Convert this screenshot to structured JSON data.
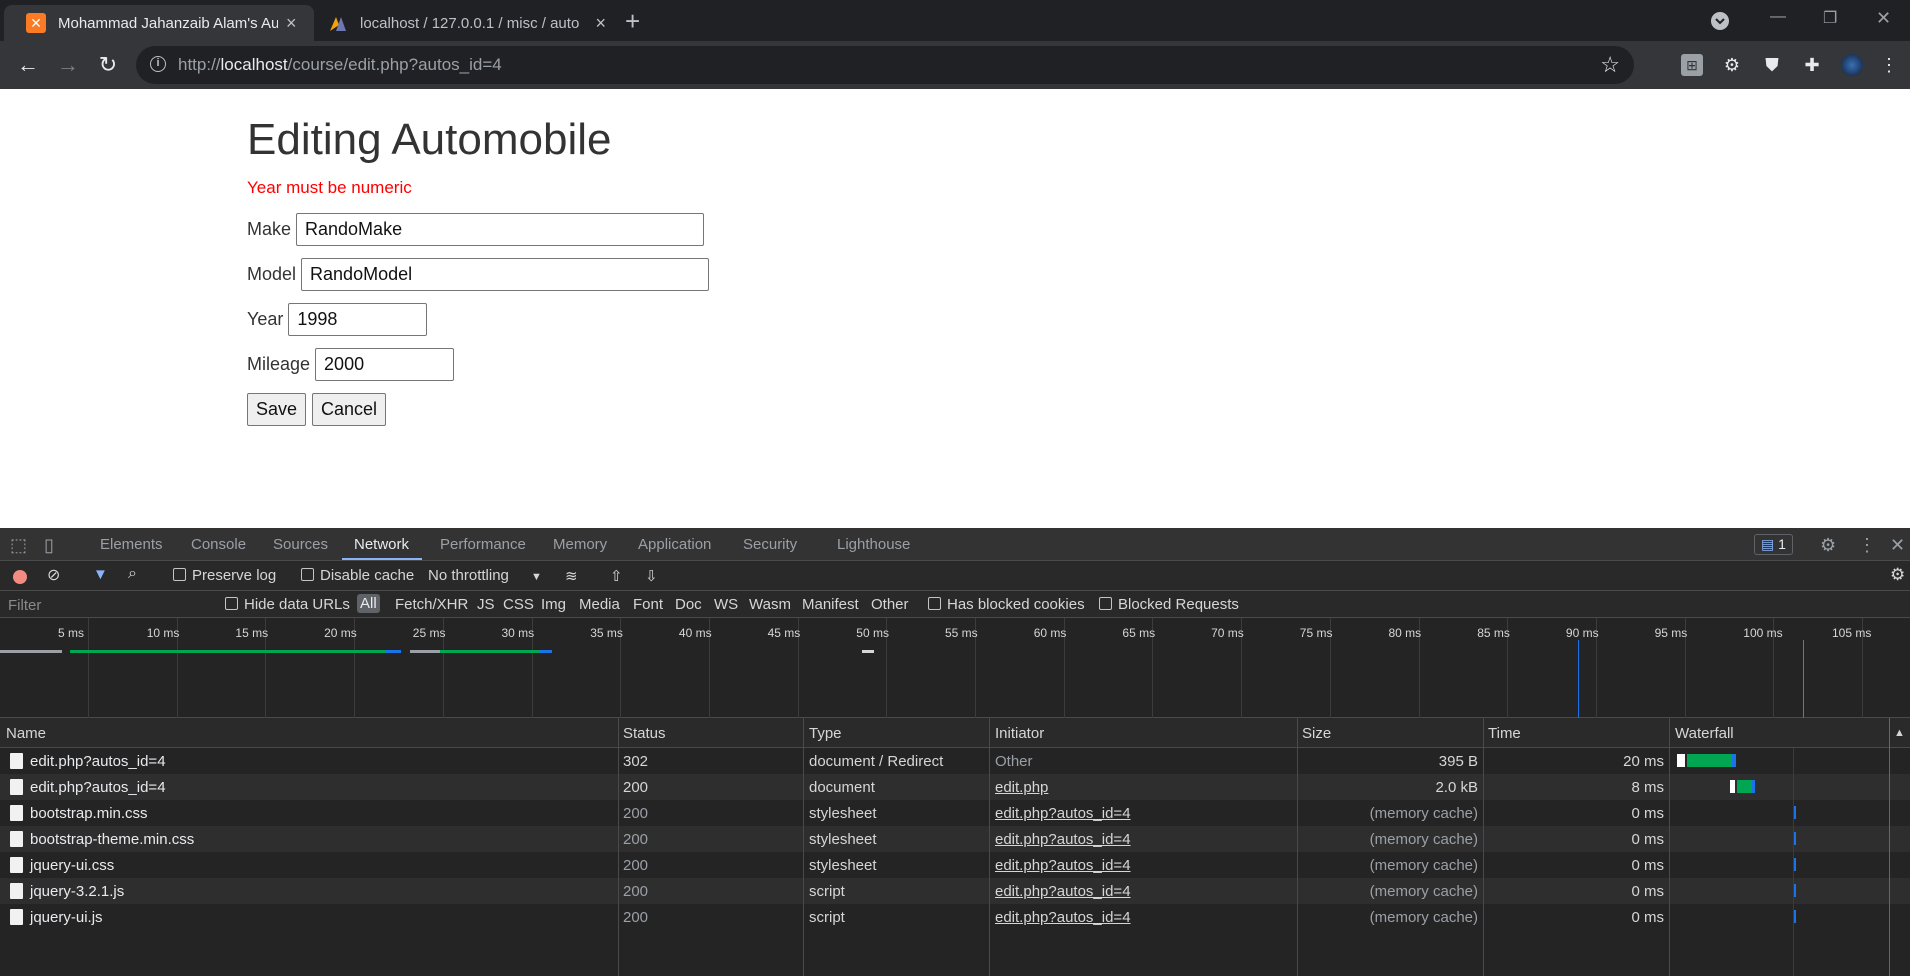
{
  "browser": {
    "tabs": [
      {
        "title": "Mohammad Jahanzaib Alam's Au",
        "active": true
      },
      {
        "title": "localhost / 127.0.0.1 / misc / auto",
        "active": false
      }
    ],
    "url_prefix": "http://",
    "url_host": "localhost",
    "url_path": "/course/edit.php?autos_id=4",
    "new_tab": "+",
    "close_glyph": "×"
  },
  "page": {
    "heading": "Editing Automobile",
    "error": "Year must be numeric",
    "fields": {
      "make": {
        "label": "Make",
        "value": "RandoMake"
      },
      "model": {
        "label": "Model",
        "value": "RandoModel"
      },
      "year": {
        "label": "Year",
        "value": "1998"
      },
      "mileage": {
        "label": "Mileage",
        "value": "2000"
      }
    },
    "buttons": {
      "save": "Save",
      "cancel": "Cancel"
    }
  },
  "devtools": {
    "tabs": [
      "Elements",
      "Console",
      "Sources",
      "Network",
      "Performance",
      "Memory",
      "Application",
      "Security",
      "Lighthouse"
    ],
    "active_tab": "Network",
    "issues_count": "1",
    "toolbar": {
      "preserve_log": "Preserve log",
      "disable_cache": "Disable cache",
      "throttling": "No throttling"
    },
    "filter_bar": {
      "filter_placeholder": "Filter",
      "hide_data_urls": "Hide data URLs",
      "types": [
        "All",
        "Fetch/XHR",
        "JS",
        "CSS",
        "Img",
        "Media",
        "Font",
        "Doc",
        "WS",
        "Wasm",
        "Manifest",
        "Other"
      ],
      "has_blocked_cookies": "Has blocked cookies",
      "blocked_requests": "Blocked Requests"
    },
    "overview_ticks": [
      "5 ms",
      "10 ms",
      "15 ms",
      "20 ms",
      "25 ms",
      "30 ms",
      "35 ms",
      "40 ms",
      "45 ms",
      "50 ms",
      "55 ms",
      "60 ms",
      "65 ms",
      "70 ms",
      "75 ms",
      "80 ms",
      "85 ms",
      "90 ms",
      "95 ms",
      "100 ms",
      "105 ms"
    ],
    "columns": [
      "Name",
      "Status",
      "Type",
      "Initiator",
      "Size",
      "Time",
      "Waterfall"
    ],
    "requests": [
      {
        "name": "edit.php?autos_id=4",
        "status": "302",
        "type": "document / Redirect",
        "initiator": "Other",
        "initiator_link": false,
        "size": "395 B",
        "time": "20 ms",
        "dim": false
      },
      {
        "name": "edit.php?autos_id=4",
        "status": "200",
        "type": "document",
        "initiator": "edit.php",
        "initiator_link": true,
        "size": "2.0 kB",
        "time": "8 ms",
        "dim": false
      },
      {
        "name": "bootstrap.min.css",
        "status": "200",
        "type": "stylesheet",
        "initiator": "edit.php?autos_id=4",
        "initiator_link": true,
        "size": "(memory cache)",
        "time": "0 ms",
        "dim": true
      },
      {
        "name": "bootstrap-theme.min.css",
        "status": "200",
        "type": "stylesheet",
        "initiator": "edit.php?autos_id=4",
        "initiator_link": true,
        "size": "(memory cache)",
        "time": "0 ms",
        "dim": true
      },
      {
        "name": "jquery-ui.css",
        "status": "200",
        "type": "stylesheet",
        "initiator": "edit.php?autos_id=4",
        "initiator_link": true,
        "size": "(memory cache)",
        "time": "0 ms",
        "dim": true
      },
      {
        "name": "jquery-3.2.1.js",
        "status": "200",
        "type": "script",
        "initiator": "edit.php?autos_id=4",
        "initiator_link": true,
        "size": "(memory cache)",
        "time": "0 ms",
        "dim": true
      },
      {
        "name": "jquery-ui.js",
        "status": "200",
        "type": "script",
        "initiator": "edit.php?autos_id=4",
        "initiator_link": true,
        "size": "(memory cache)",
        "time": "0 ms",
        "dim": true
      }
    ],
    "colors": {
      "waiting": "#00a651",
      "receiving": "#1a73e8",
      "domcontentloaded": "#1a73e8",
      "load": "#e8453c",
      "record": "#f28b82"
    }
  }
}
